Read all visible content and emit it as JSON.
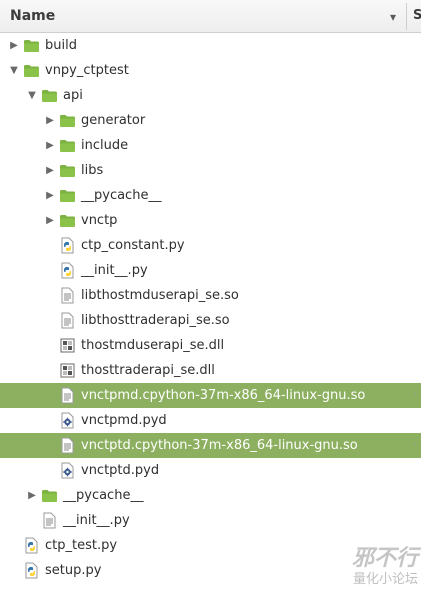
{
  "header": {
    "name_label": "Name",
    "sort_icon": "chevron-down-icon",
    "next_label": "S"
  },
  "colors": {
    "folder": "#7cb342",
    "selection": "#8cb060",
    "python_blue": "#3776ab",
    "python_yellow": "#ffd43b"
  },
  "tree": [
    {
      "label": "build",
      "type": "folder",
      "depth": 0,
      "expander": "collapsed",
      "selected": false
    },
    {
      "label": "vnpy_ctptest",
      "type": "folder",
      "depth": 0,
      "expander": "expanded",
      "selected": false
    },
    {
      "label": "api",
      "type": "folder",
      "depth": 1,
      "expander": "expanded",
      "selected": false
    },
    {
      "label": "generator",
      "type": "folder",
      "depth": 2,
      "expander": "collapsed",
      "selected": false
    },
    {
      "label": "include",
      "type": "folder",
      "depth": 2,
      "expander": "collapsed",
      "selected": false
    },
    {
      "label": "libs",
      "type": "folder",
      "depth": 2,
      "expander": "collapsed",
      "selected": false
    },
    {
      "label": "__pycache__",
      "type": "folder",
      "depth": 2,
      "expander": "collapsed",
      "selected": false
    },
    {
      "label": "vnctp",
      "type": "folder",
      "depth": 2,
      "expander": "collapsed",
      "selected": false
    },
    {
      "label": "ctp_constant.py",
      "type": "python",
      "depth": 2,
      "expander": "none",
      "selected": false
    },
    {
      "label": "__init__.py",
      "type": "python",
      "depth": 2,
      "expander": "none",
      "selected": false
    },
    {
      "label": "libthostmduserapi_se.so",
      "type": "text",
      "depth": 2,
      "expander": "none",
      "selected": false
    },
    {
      "label": "libthosttraderapi_se.so",
      "type": "text",
      "depth": 2,
      "expander": "none",
      "selected": false
    },
    {
      "label": "thostmduserapi_se.dll",
      "type": "dll",
      "depth": 2,
      "expander": "none",
      "selected": false
    },
    {
      "label": "thosttraderapi_se.dll",
      "type": "dll",
      "depth": 2,
      "expander": "none",
      "selected": false
    },
    {
      "label": "vnctpmd.cpython-37m-x86_64-linux-gnu.so",
      "type": "text",
      "depth": 2,
      "expander": "none",
      "selected": true
    },
    {
      "label": "vnctpmd.pyd",
      "type": "gear",
      "depth": 2,
      "expander": "none",
      "selected": false
    },
    {
      "label": "vnctptd.cpython-37m-x86_64-linux-gnu.so",
      "type": "text",
      "depth": 2,
      "expander": "none",
      "selected": true
    },
    {
      "label": "vnctptd.pyd",
      "type": "gear",
      "depth": 2,
      "expander": "none",
      "selected": false
    },
    {
      "label": "__pycache__",
      "type": "folder",
      "depth": 1,
      "expander": "collapsed",
      "selected": false
    },
    {
      "label": "__init__.py",
      "type": "text",
      "depth": 1,
      "expander": "none",
      "selected": false
    },
    {
      "label": "ctp_test.py",
      "type": "python",
      "depth": 0,
      "expander": "none",
      "selected": false
    },
    {
      "label": "setup.py",
      "type": "python",
      "depth": 0,
      "expander": "none",
      "selected": false
    }
  ],
  "watermark": {
    "main": "邪不行",
    "sub": "量化小论坛"
  }
}
